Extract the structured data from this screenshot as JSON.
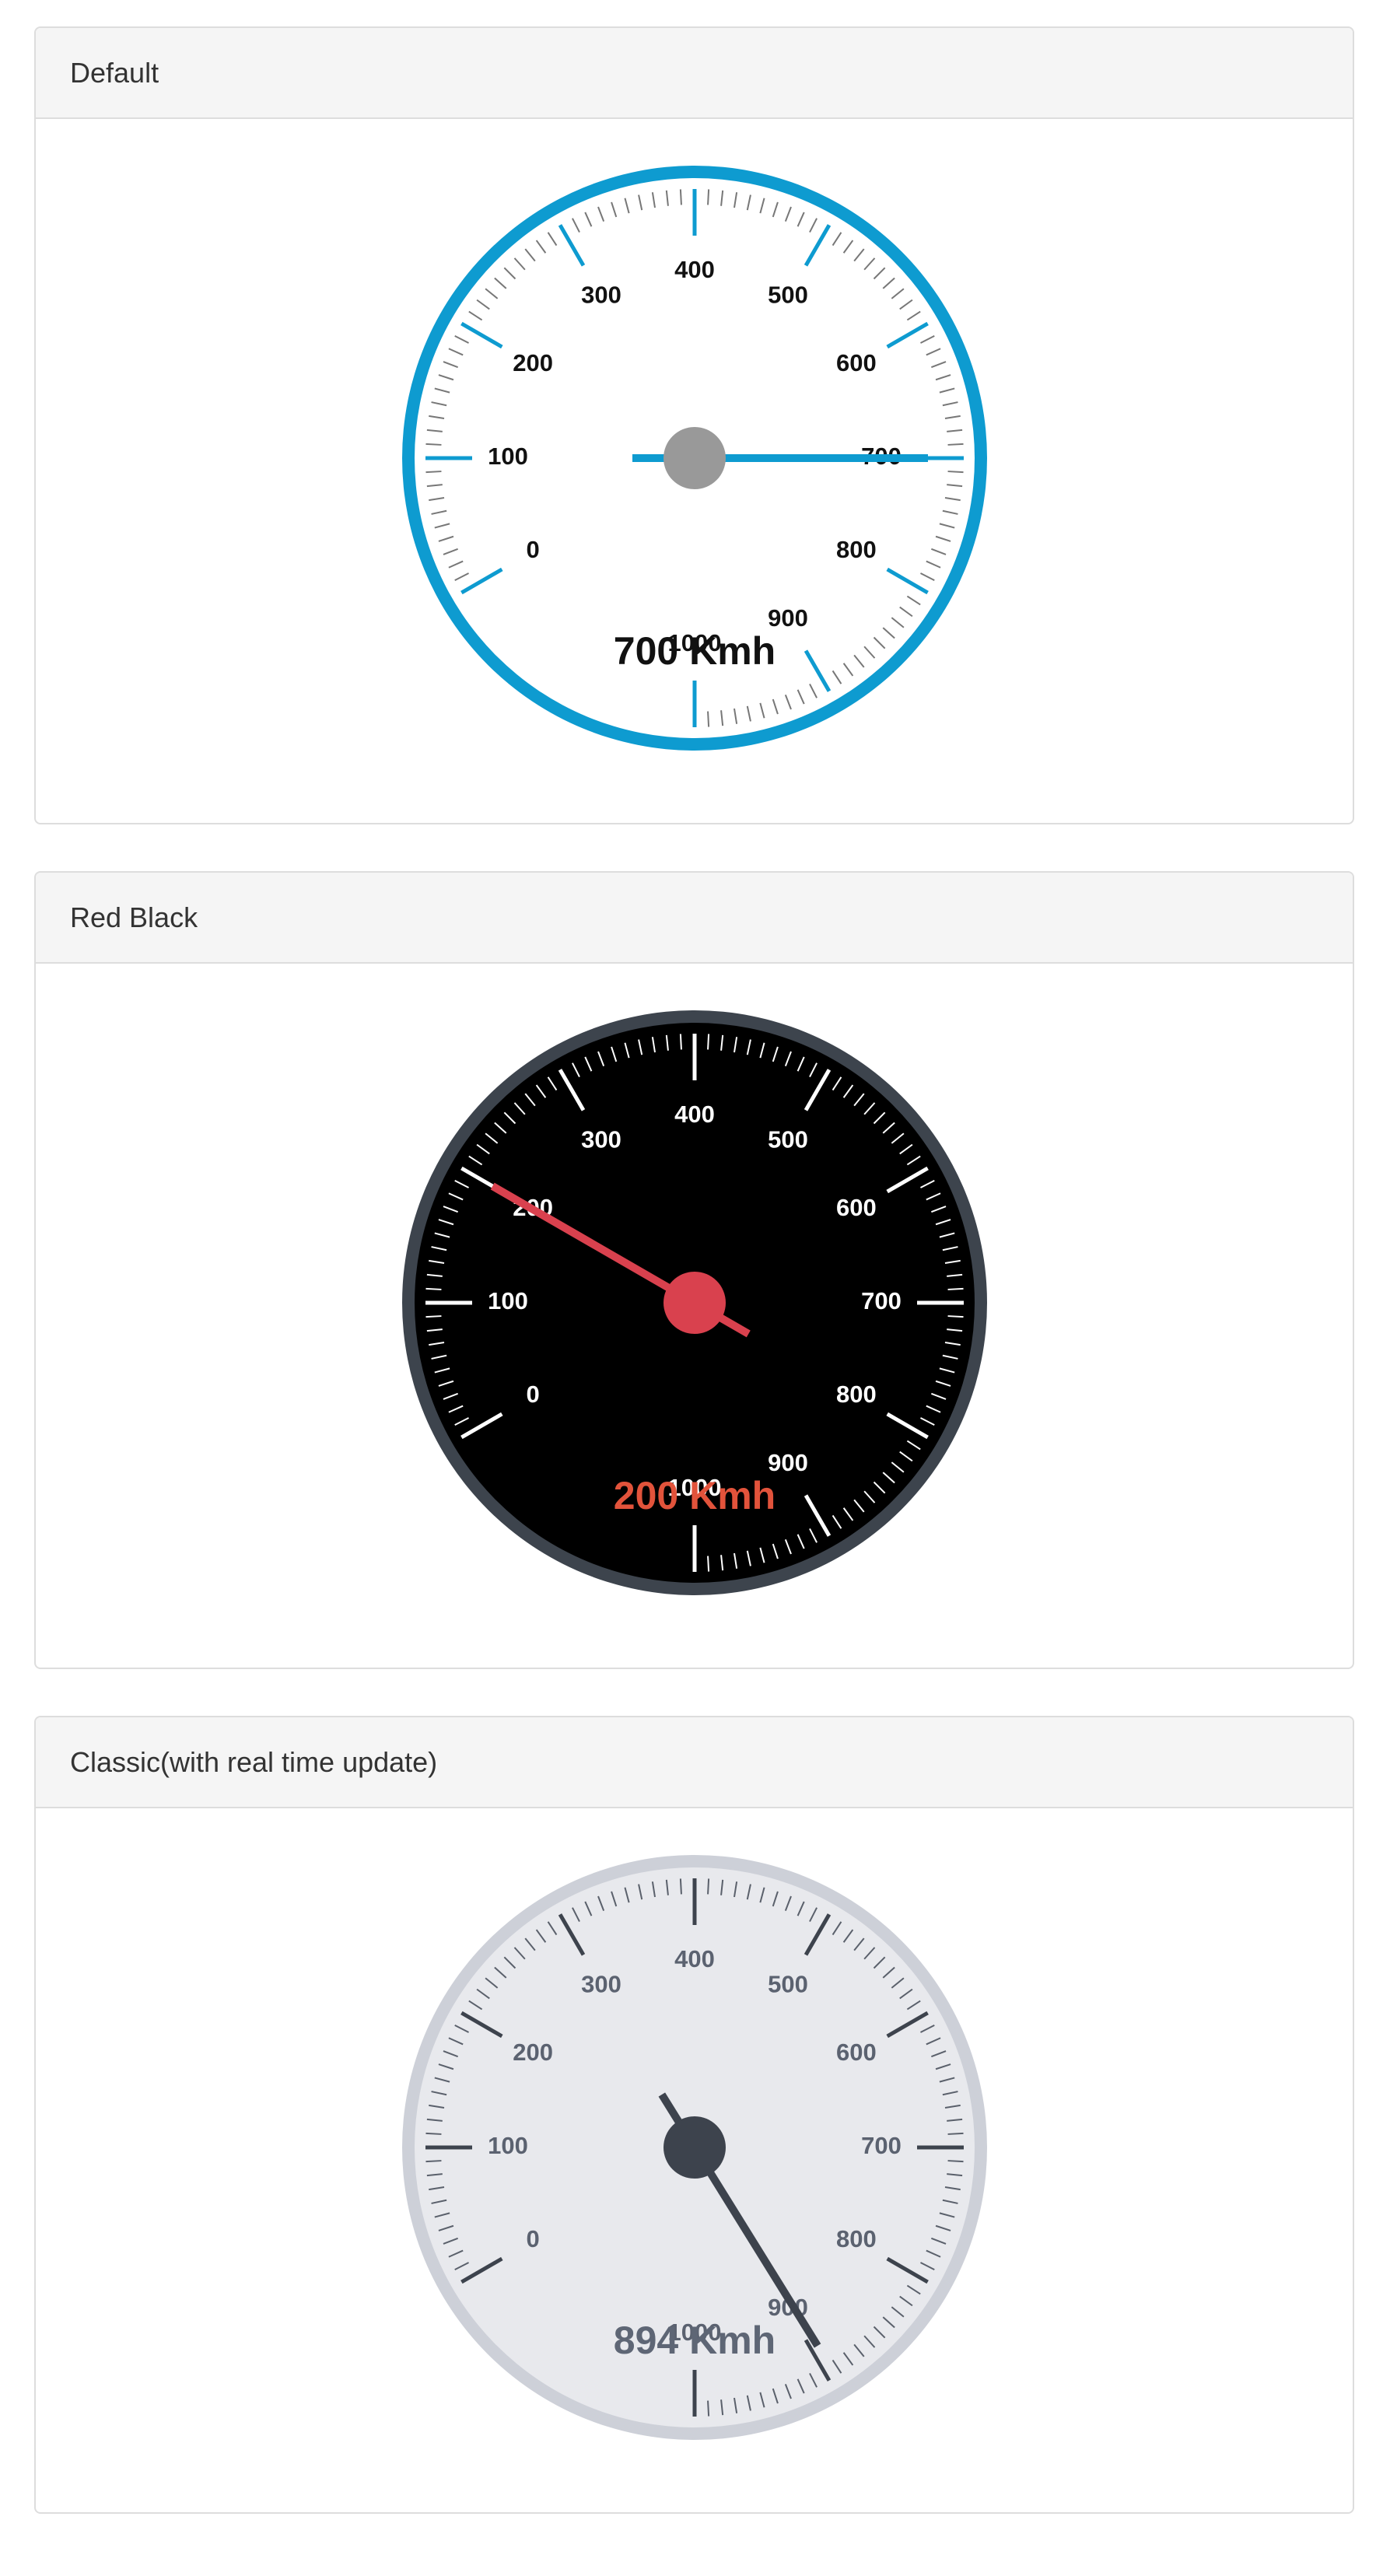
{
  "panels": [
    {
      "title": "Default",
      "gauge": {
        "value": 700,
        "min": 0,
        "max": 1000,
        "unit": "Kmh",
        "value_text": "700 Kmh",
        "tick_labels": [
          "0",
          "100",
          "200",
          "300",
          "400",
          "500",
          "600",
          "700",
          "800",
          "900",
          "1000"
        ],
        "colors": {
          "ring": "#0e9bd0",
          "face": "#ffffff",
          "major_tick": "#0e9bd0",
          "minor_tick": "#777777",
          "label": "#111111",
          "needle": "#0e9bd0",
          "hub": "#999999",
          "value_text": "#111111"
        }
      }
    },
    {
      "title": "Red Black",
      "gauge": {
        "value": 200,
        "min": 0,
        "max": 1000,
        "unit": "Kmh",
        "value_text": "200 Kmh",
        "tick_labels": [
          "0",
          "100",
          "200",
          "300",
          "400",
          "500",
          "600",
          "700",
          "800",
          "900",
          "1000"
        ],
        "colors": {
          "ring": "#3d444d",
          "face": "#000000",
          "major_tick": "#ffffff",
          "minor_tick": "#ffffff",
          "label": "#ffffff",
          "needle": "#d9414e",
          "hub": "#d9414e",
          "value_text": "#e2533b"
        }
      }
    },
    {
      "title": "Classic(with real time update)",
      "gauge": {
        "value": 894,
        "min": 0,
        "max": 1000,
        "unit": "Kmh",
        "value_text": "894 Kmh",
        "tick_labels": [
          "0",
          "100",
          "200",
          "300",
          "400",
          "500",
          "600",
          "700",
          "800",
          "900",
          "1000"
        ],
        "colors": {
          "ring": "#cdd0d8",
          "face": "#e8e9ed",
          "major_tick": "#3d434d",
          "minor_tick": "#5a606b",
          "label": "#5b6270",
          "needle": "#3d434d",
          "hub": "#3d434d",
          "value_text": "#5e6675"
        }
      }
    }
  ]
}
